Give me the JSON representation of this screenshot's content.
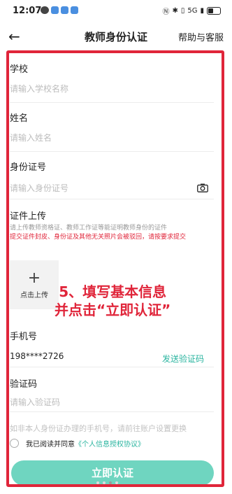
{
  "status_bar": {
    "time": "12:07",
    "network": "5G"
  },
  "header": {
    "back_icon": "arrow-left-icon",
    "title": "教师身份认证",
    "help": "帮助与客服"
  },
  "form": {
    "school": {
      "label": "学校",
      "placeholder": "请输入学校名称"
    },
    "name": {
      "label": "姓名",
      "placeholder": "请输入姓名"
    },
    "id_number": {
      "label": "身份证号",
      "placeholder": "请输入身份证号"
    },
    "upload": {
      "label": "证件上传",
      "hint": "请上传教师资格证、教师工作证等能证明教师身份的证件",
      "warning": "提交证件封皮、身份证及其他无关照片会被驳回，请按要求提交",
      "button": "点击上传"
    },
    "phone": {
      "label": "手机号",
      "value": "198****2726",
      "send_code": "发送验证码"
    },
    "code": {
      "label": "验证码",
      "placeholder": "请输入验证码"
    },
    "note": "如非本人身份证办理的手机号，请前往账户设置更换"
  },
  "annotation": {
    "line1": "5、填写基本信息",
    "line2": "并点击“立即认证”"
  },
  "agreement": {
    "prefix": "我已阅读并同意",
    "link": "《个人信息授权协议》"
  },
  "submit_label": "立即认证",
  "colors": {
    "accent": "#2bb5a0",
    "button": "#6fd5c0",
    "annotation": "#e0253a"
  }
}
